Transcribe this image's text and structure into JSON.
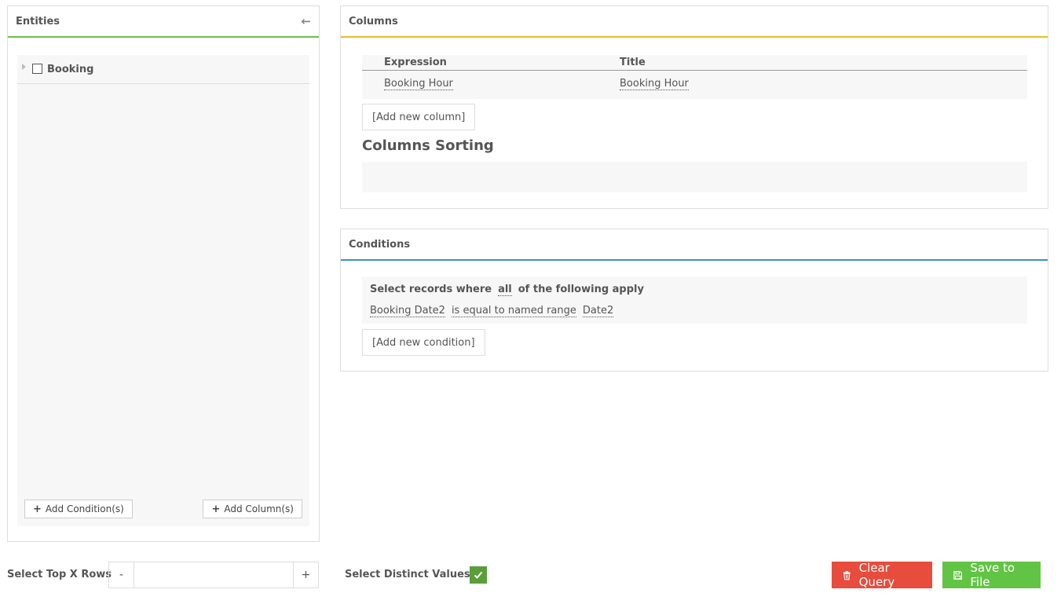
{
  "entities": {
    "title": "Entities",
    "tree": [
      {
        "label": "Booking"
      }
    ],
    "add_conditions_label": "Add Condition(s)",
    "add_columns_label": "Add Column(s)"
  },
  "columns": {
    "title": "Columns",
    "headers": [
      "Expression",
      "Title"
    ],
    "rows": [
      {
        "expression": "Booking Hour",
        "title": "Booking Hour"
      }
    ],
    "add_label": "[Add new column]",
    "sorting_title": "Columns Sorting"
  },
  "conditions": {
    "title": "Conditions",
    "lead_text": "Select records where",
    "mode": "all",
    "trail_text": "of the following apply",
    "items": [
      {
        "field": "Booking Date2",
        "operator": "is equal to named range",
        "value": "Date2"
      }
    ],
    "add_label": "[Add new condition]"
  },
  "bottom": {
    "top_rows_label": "Select Top X Rows",
    "minus_label": "-",
    "plus_label": "+",
    "top_rows_value": "",
    "distinct_label": "Select Distinct Values?",
    "clear_label": "Clear Query",
    "save_label": "Save to File"
  },
  "icons": {
    "collapse": "arrow-left-icon",
    "expand": "triangle-right-icon",
    "trash": "trash-icon",
    "save": "floppy-icon",
    "check": "check-icon"
  },
  "colors": {
    "entities_accent": "#6cc04a",
    "columns_accent": "#e3c11f",
    "conditions_accent": "#3a8fc9",
    "clear": "#e74c3c",
    "save": "#62c444",
    "checkbox": "#5a9e3a"
  }
}
